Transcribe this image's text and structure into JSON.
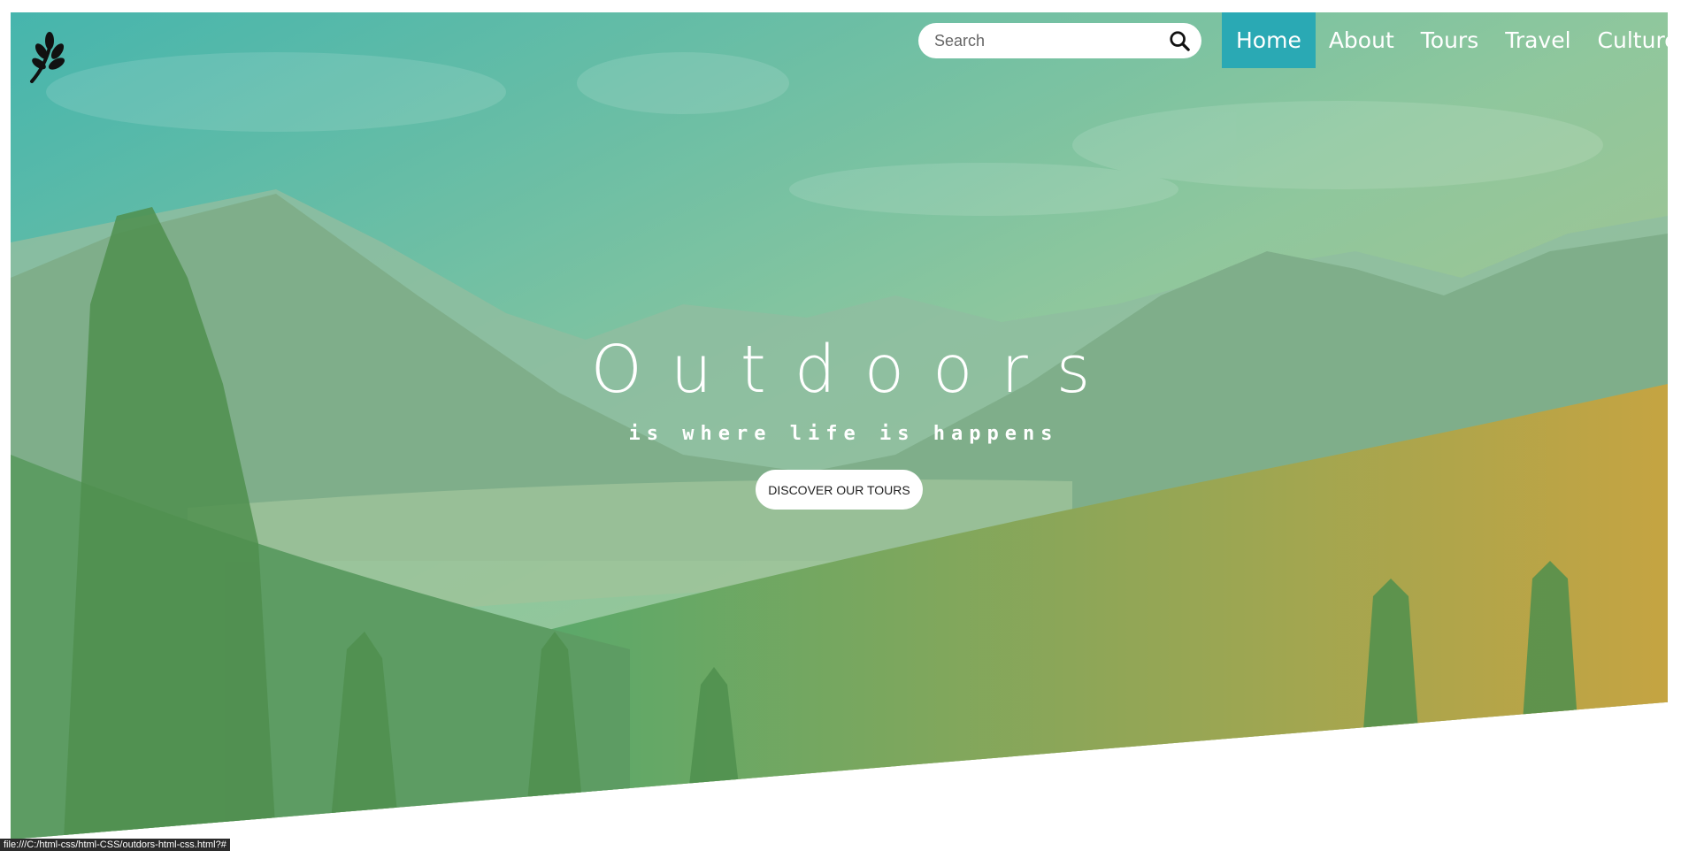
{
  "header": {
    "logo_icon": "leaf-branch-icon",
    "search": {
      "placeholder": "Search",
      "value": "",
      "icon": "search-icon"
    },
    "nav": [
      {
        "label": "Home",
        "active": true
      },
      {
        "label": "About",
        "active": false
      },
      {
        "label": "Tours",
        "active": false
      },
      {
        "label": "Travel",
        "active": false
      },
      {
        "label": "Culture",
        "active": false
      }
    ]
  },
  "hero": {
    "title": "Outdoors",
    "subtitle": "is where life is happens",
    "cta_label": "DISCOVER OUR TOURS"
  },
  "status_bar": {
    "url": "file:///C:/html-css/html-CSS/outdors-html-css.html?#"
  },
  "colors": {
    "nav_active": "#2aa9b4",
    "gradient_start": "#3fb3b0",
    "gradient_end": "#c7a94e",
    "text_on_hero": "#ffffff"
  }
}
